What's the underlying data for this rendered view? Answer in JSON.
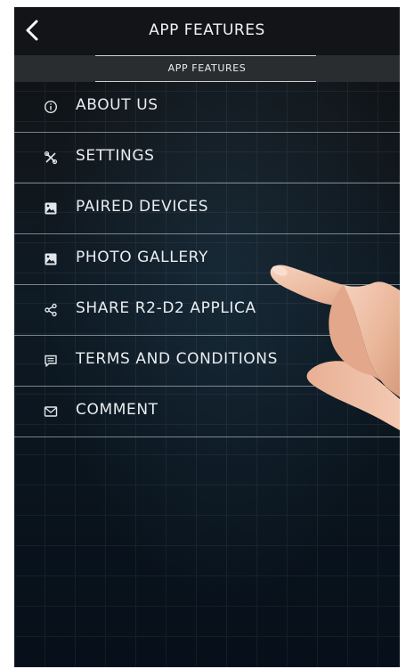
{
  "header": {
    "title": "APP FEATURES",
    "back_icon": "chevron-left-icon"
  },
  "subheader": {
    "title": "APP FEATURES"
  },
  "menu": {
    "items": [
      {
        "label": "ABOUT US",
        "icon": "info-icon"
      },
      {
        "label": "SETTINGS",
        "icon": "tools-icon"
      },
      {
        "label": "PAIRED DEVICES",
        "icon": "image-icon"
      },
      {
        "label": "PHOTO GALLERY",
        "icon": "image-icon"
      },
      {
        "label": "SHARE R2-D2 APPLICA",
        "icon": "share-icon"
      },
      {
        "label": "TERMS AND CONDITIONS",
        "icon": "message-icon"
      },
      {
        "label": "COMMENT",
        "icon": "mail-icon"
      }
    ]
  },
  "overlay": {
    "icon": "pointing-hand-icon"
  },
  "colors": {
    "header_bg": "#121417",
    "subheader_bg": "#2a2d30",
    "text": "#e9edf1",
    "divider": "#cfd8e0"
  }
}
